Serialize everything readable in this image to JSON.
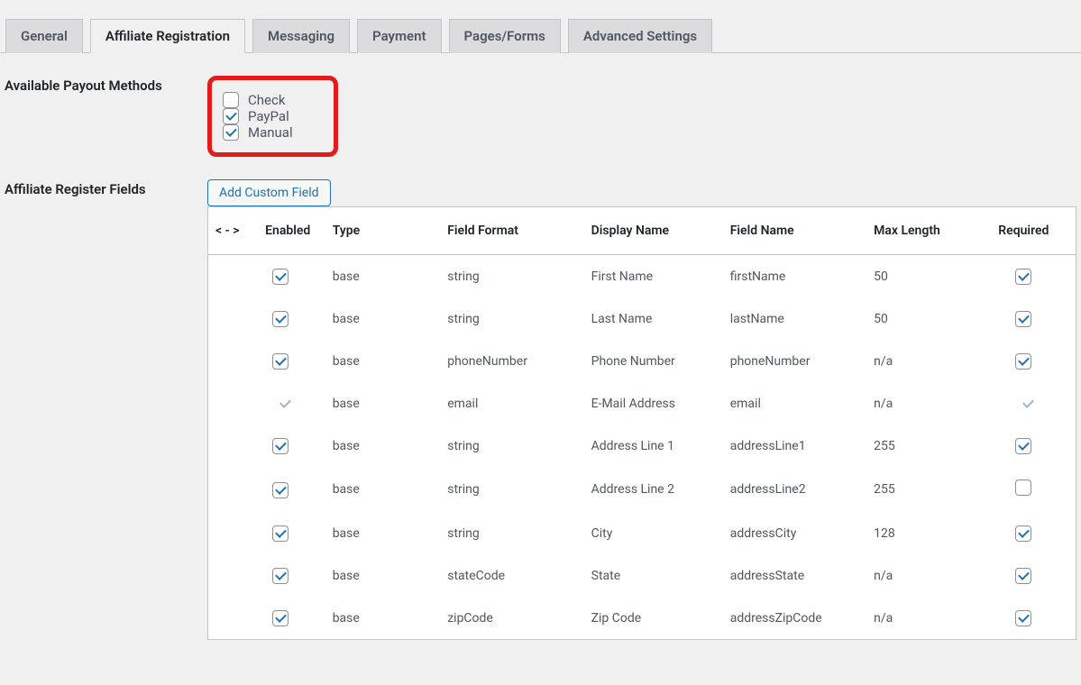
{
  "tabs": [
    {
      "label": "General",
      "active": false
    },
    {
      "label": "Affiliate Registration",
      "active": true
    },
    {
      "label": "Messaging",
      "active": false
    },
    {
      "label": "Payment",
      "active": false
    },
    {
      "label": "Pages/Forms",
      "active": false
    },
    {
      "label": "Advanced Settings",
      "active": false
    }
  ],
  "payout": {
    "label": "Available Payout Methods",
    "options": [
      {
        "label": "Check",
        "checked": false
      },
      {
        "label": "PayPal",
        "checked": true
      },
      {
        "label": "Manual",
        "checked": true
      }
    ]
  },
  "registerFields": {
    "label": "Affiliate Register Fields",
    "addBtn": "Add Custom Field",
    "columns": {
      "sort": "< - >",
      "enabled": "Enabled",
      "type": "Type",
      "format": "Field Format",
      "display": "Display Name",
      "field": "Field Name",
      "max": "Max Length",
      "required": "Required"
    },
    "rows": [
      {
        "enabled": true,
        "enabledLocked": false,
        "type": "base",
        "format": "string",
        "display": "First Name",
        "field": "firstName",
        "max": "50",
        "required": true,
        "requiredLocked": false
      },
      {
        "enabled": true,
        "enabledLocked": false,
        "type": "base",
        "format": "string",
        "display": "Last Name",
        "field": "lastName",
        "max": "50",
        "required": true,
        "requiredLocked": false
      },
      {
        "enabled": true,
        "enabledLocked": false,
        "type": "base",
        "format": "phoneNumber",
        "display": "Phone Number",
        "field": "phoneNumber",
        "max": "n/a",
        "required": true,
        "requiredLocked": false
      },
      {
        "enabled": true,
        "enabledLocked": true,
        "type": "base",
        "format": "email",
        "display": "E-Mail Address",
        "field": "email",
        "max": "n/a",
        "required": true,
        "requiredLocked": true
      },
      {
        "enabled": true,
        "enabledLocked": false,
        "type": "base",
        "format": "string",
        "display": "Address Line 1",
        "field": "addressLine1",
        "max": "255",
        "required": true,
        "requiredLocked": false
      },
      {
        "enabled": true,
        "enabledLocked": false,
        "type": "base",
        "format": "string",
        "display": "Address Line 2",
        "field": "addressLine2",
        "max": "255",
        "required": false,
        "requiredLocked": false
      },
      {
        "enabled": true,
        "enabledLocked": false,
        "type": "base",
        "format": "string",
        "display": "City",
        "field": "addressCity",
        "max": "128",
        "required": true,
        "requiredLocked": false
      },
      {
        "enabled": true,
        "enabledLocked": false,
        "type": "base",
        "format": "stateCode",
        "display": "State",
        "field": "addressState",
        "max": "n/a",
        "required": true,
        "requiredLocked": false
      },
      {
        "enabled": true,
        "enabledLocked": false,
        "type": "base",
        "format": "zipCode",
        "display": "Zip Code",
        "field": "addressZipCode",
        "max": "n/a",
        "required": true,
        "requiredLocked": false
      }
    ]
  }
}
